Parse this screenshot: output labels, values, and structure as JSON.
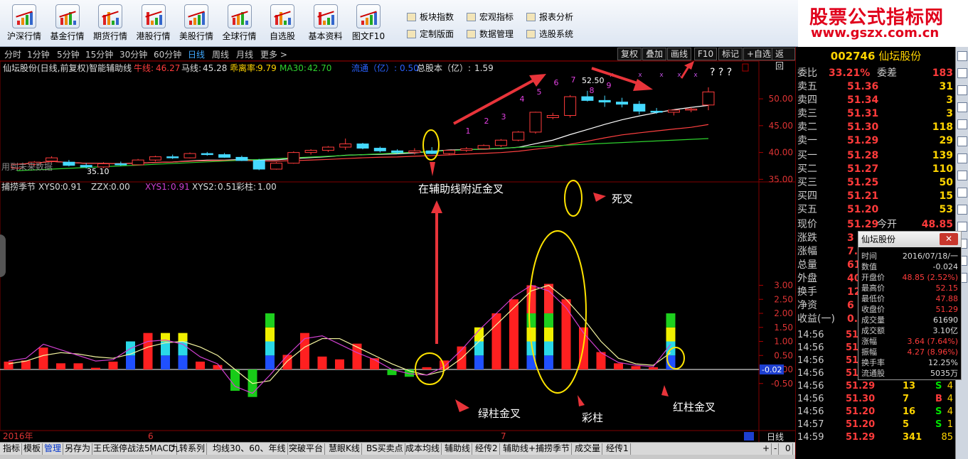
{
  "toolbar": {
    "buttons": [
      {
        "label": "沪深行情",
        "icon": "market-chart-icon"
      },
      {
        "label": "基金行情",
        "icon": "fund-chart-icon"
      },
      {
        "label": "期货行情",
        "icon": "futures-chart-icon"
      },
      {
        "label": "港股行情",
        "icon": "hk-chart-icon"
      },
      {
        "label": "美股行情",
        "icon": "us-chart-icon"
      },
      {
        "label": "全球行情",
        "icon": "global-chart-icon"
      },
      {
        "label": "自选股",
        "icon": "watchlist-icon"
      },
      {
        "label": "基本资料",
        "icon": "key-icon"
      },
      {
        "label": "图文F10",
        "icon": "f10-doc-icon"
      }
    ],
    "menu": [
      {
        "label": "板块指数"
      },
      {
        "label": "宏观指标"
      },
      {
        "label": "报表分析"
      },
      {
        "label": "定制版面"
      },
      {
        "label": "数据管理"
      },
      {
        "label": "选股系统"
      }
    ]
  },
  "brand": {
    "title": "股票公式指标网",
    "url": "www.gszx.com.cn"
  },
  "periods": [
    "分时",
    "1分钟",
    "5分钟",
    "15分钟",
    "30分钟",
    "60分钟",
    "日线",
    "周线",
    "月线",
    "更多 >"
  ],
  "active_period": "日线",
  "function_buttons": [
    "复权",
    "叠加",
    "画线",
    "F10",
    "标记",
    "+自选",
    "返回"
  ],
  "main_chart": {
    "legend": {
      "title": "仙坛股份(日线,前复权)智能辅助线",
      "ma1_label": "牛线:",
      "ma1_value": "46.27",
      "ma2_label": "马线:",
      "ma2_value": "45.28",
      "bias_label": "乖离率:",
      "bias_value": "9.79",
      "ma30_label": "MA30:",
      "ma30_value": "42.70",
      "float_label": "流通（亿）:",
      "float_value": "0.50",
      "total_label": "总股本（亿）:",
      "total_value": "1.59"
    },
    "yticks": [
      "50.00",
      "45.00",
      "40.00",
      "35.00"
    ],
    "low_label": "35.10",
    "high_label": "52.50",
    "future_label": "用到未来数据",
    "question_marks": "? ? ?",
    "candles": [
      [
        37.1,
        37.9,
        36.8,
        37.8
      ],
      [
        37.8,
        38.4,
        37.5,
        38.2
      ],
      [
        38.4,
        39.3,
        38.1,
        39.0
      ],
      [
        38.2,
        38.6,
        37.4,
        37.6
      ],
      [
        37.6,
        38.0,
        37.0,
        37.3
      ],
      [
        37.3,
        38.2,
        37.1,
        37.9
      ],
      [
        37.9,
        38.3,
        37.5,
        37.7
      ],
      [
        37.7,
        38.8,
        37.6,
        38.6
      ],
      [
        38.6,
        39.4,
        38.3,
        39.2
      ],
      [
        39.2,
        39.6,
        38.8,
        39.0
      ],
      [
        39.0,
        40.0,
        38.9,
        39.8
      ],
      [
        39.8,
        40.1,
        39.4,
        39.6
      ],
      [
        39.6,
        39.9,
        39.0,
        39.1
      ],
      [
        39.1,
        39.4,
        38.4,
        38.5
      ],
      [
        38.5,
        38.8,
        36.7,
        36.9
      ],
      [
        36.9,
        38.2,
        36.8,
        38.0
      ],
      [
        38.0,
        40.2,
        37.9,
        40.0
      ],
      [
        40.0,
        40.6,
        39.6,
        40.4
      ],
      [
        40.4,
        41.2,
        40.1,
        41.0
      ],
      [
        41.0,
        42.6,
        40.5,
        41.6
      ],
      [
        41.6,
        41.8,
        40.6,
        40.8
      ],
      [
        40.8,
        41.1,
        40.0,
        40.3
      ],
      [
        40.3,
        40.6,
        39.7,
        40.0
      ],
      [
        40.0,
        40.8,
        39.6,
        40.3
      ],
      [
        40.3,
        41.0,
        39.7,
        39.8
      ],
      [
        39.8,
        40.5,
        39.5,
        40.4
      ],
      [
        40.4,
        41.0,
        40.1,
        40.7
      ],
      [
        40.7,
        41.5,
        40.5,
        41.3
      ],
      [
        41.3,
        42.5,
        41.0,
        42.3
      ],
      [
        42.3,
        44.0,
        42.1,
        43.8
      ],
      [
        43.8,
        47.6,
        43.5,
        47.5
      ],
      [
        46.5,
        47.4,
        46.2,
        46.9
      ],
      [
        46.9,
        50.7,
        46.5,
        50.4
      ],
      [
        50.4,
        51.5,
        49.5,
        49.7
      ],
      [
        49.7,
        50.6,
        48.5,
        49.4
      ],
      [
        49.4,
        50.2,
        48.4,
        49.0
      ],
      [
        49.0,
        49.6,
        47.1,
        47.7
      ],
      [
        47.7,
        48.3,
        47.2,
        47.5
      ],
      [
        47.5,
        48.0,
        46.9,
        47.9
      ],
      [
        47.9,
        48.4,
        47.5,
        48.1
      ],
      [
        48.85,
        52.15,
        47.88,
        51.29
      ]
    ],
    "top_numbers": [
      "1",
      "2",
      "3",
      "4",
      "5",
      "6",
      "7",
      "8",
      "9"
    ],
    "annotation": "在辅助线附近金叉"
  },
  "sub_chart": {
    "legend": {
      "title": "捕捞季节",
      "xys0_label": "XYS0:",
      "xys0_value": "0.91",
      "zzx_label": "ZZX:",
      "zzx_value": "0.00",
      "xys1_label": "XYS1:",
      "xys1_value": "0.91",
      "xys2_label": "XYS2:",
      "xys2_value": "0.51",
      "caizhu_label": "彩柱:",
      "caizhu_value": "1.00"
    },
    "yticks": [
      "3.00",
      "2.50",
      "2.00",
      "1.50",
      "1.00",
      "0.50",
      "0.00",
      "-0.50"
    ],
    "current_value": "-0.02",
    "bars": [
      0.28,
      0.32,
      0.78,
      0.22,
      0.22,
      0.06,
      0.28,
      1.0,
      1.3,
      1.3,
      1.3,
      0.28,
      0.16,
      -0.76,
      -0.98,
      2.0,
      0.52,
      1.3,
      0.46,
      0.36,
      0.92,
      0.4,
      -0.2,
      -0.26,
      0.08,
      0.32,
      0.82,
      1.5,
      2.0,
      2.5,
      3.0,
      3.05,
      2.5,
      1.5,
      0.62,
      0.22,
      0.12,
      0.08,
      2.0
    ],
    "colorful": [
      false,
      false,
      false,
      false,
      false,
      false,
      false,
      true,
      false,
      true,
      true,
      false,
      false,
      false,
      false,
      true,
      false,
      false,
      false,
      false,
      false,
      false,
      false,
      false,
      false,
      false,
      false,
      true,
      false,
      false,
      true,
      true,
      false,
      false,
      false,
      false,
      false,
      false,
      true
    ],
    "line_xys1": [
      0.3,
      0.4,
      0.9,
      0.7,
      0.5,
      0.3,
      0.35,
      0.75,
      1.0,
      1.05,
      0.9,
      0.45,
      0.2,
      -0.6,
      -0.85,
      -0.2,
      0.5,
      1.1,
      1.2,
      0.9,
      0.6,
      0.35,
      0.0,
      -0.15,
      -0.2,
      0.1,
      0.7,
      1.4,
      2.0,
      2.6,
      3.0,
      2.8,
      2.2,
      1.3,
      0.6,
      0.25,
      0.15,
      0.1,
      0.9
    ],
    "line_xys2": [
      0.2,
      0.3,
      0.5,
      0.6,
      0.55,
      0.45,
      0.4,
      0.55,
      0.8,
      0.95,
      1.0,
      0.8,
      0.5,
      0.0,
      -0.5,
      -0.4,
      0.3,
      0.8,
      1.1,
      1.1,
      0.8,
      0.5,
      0.2,
      -0.05,
      -0.2,
      -0.05,
      0.4,
      1.0,
      1.6,
      2.2,
      2.8,
      3.0,
      2.5,
      1.8,
      1.0,
      0.4,
      0.2,
      0.15,
      0.6
    ],
    "annotations": {
      "death_cross": "死叉",
      "green_cross": "绿柱金叉",
      "colorful": "彩柱",
      "red_cross": "红柱金叉"
    }
  },
  "xaxis": {
    "labels": [
      "2016年",
      "6",
      "7"
    ],
    "period": "日线"
  },
  "tabs": [
    "指标",
    "模板",
    "管理",
    "另存为",
    "王氏涨停战法5",
    "MACD",
    "九转系列",
    "均线30、60、年线",
    "突破平台",
    "慧眼K线",
    "BS买卖点",
    "成本均线",
    "辅助线",
    "经传2",
    "辅助线+捕捞季节",
    "成交量",
    "经传1"
  ],
  "active_tab": "管理",
  "tab_controls": [
    "+",
    "-",
    "0"
  ],
  "quote": {
    "code": "002746",
    "name": "仙坛股份",
    "weibi_label": "委比",
    "weibi": "33.21%",
    "weicha_label": "委差",
    "weicha": "183",
    "asks": [
      {
        "label": "卖五",
        "price": "51.36",
        "vol": "31"
      },
      {
        "label": "卖四",
        "price": "51.34",
        "vol": "3"
      },
      {
        "label": "卖三",
        "price": "51.31",
        "vol": "3"
      },
      {
        "label": "卖二",
        "price": "51.30",
        "vol": "118"
      },
      {
        "label": "卖一",
        "price": "51.29",
        "vol": "29"
      }
    ],
    "bids": [
      {
        "label": "买一",
        "price": "51.28",
        "vol": "139"
      },
      {
        "label": "买二",
        "price": "51.27",
        "vol": "110"
      },
      {
        "label": "买三",
        "price": "51.25",
        "vol": "50"
      },
      {
        "label": "买四",
        "price": "51.21",
        "vol": "15"
      },
      {
        "label": "买五",
        "price": "51.20",
        "vol": "53"
      }
    ],
    "stats": [
      {
        "label": "现价",
        "value": "51.29",
        "label2": "今开",
        "value2": "48.85"
      },
      {
        "label": "涨跌",
        "value": "3"
      },
      {
        "label": "涨幅",
        "value": "7."
      },
      {
        "label": "总量",
        "value": "61"
      },
      {
        "label": "外盘",
        "value": "40"
      },
      {
        "label": "换手",
        "value": "12."
      },
      {
        "label": "净资",
        "value": "6"
      },
      {
        "label": "收益(一)",
        "value": "0."
      }
    ],
    "ticks": [
      {
        "time": "14:56",
        "price": "51"
      },
      {
        "time": "14:56",
        "price": "51"
      },
      {
        "time": "14:56",
        "price": "51"
      },
      {
        "time": "14:56",
        "price": "51"
      },
      {
        "time": "14:56",
        "price": "51.29",
        "vol": "13",
        "bs": "S",
        "n": "4"
      },
      {
        "time": "14:56",
        "price": "51.30",
        "vol": "7",
        "bs": "B",
        "n": "4"
      },
      {
        "time": "14:56",
        "price": "51.20",
        "vol": "16",
        "bs": "S",
        "n": "4"
      },
      {
        "time": "14:57",
        "price": "51.20",
        "vol": "5",
        "bs": "S",
        "n": "1"
      },
      {
        "time": "14:59",
        "price": "51.29",
        "vol": "341",
        "bs": "",
        "n": "85"
      }
    ],
    "colors": {
      "up": "#ff3b3b",
      "down": "#00e000",
      "accent": "#ffd400"
    }
  },
  "popup": {
    "title": "仙坛股份",
    "rows": [
      {
        "label": "时间",
        "value": "2016/07/18/一"
      },
      {
        "label": "数值",
        "value": "-0.024"
      },
      {
        "label": "开盘价",
        "value": "48.85 (2.52%)"
      },
      {
        "label": "最高价",
        "value": "52.15"
      },
      {
        "label": "最低价",
        "value": "47.88"
      },
      {
        "label": "收盘价",
        "value": "51.29"
      },
      {
        "label": "成交量",
        "value": "61690"
      },
      {
        "label": "成交额",
        "value": "3.10亿"
      },
      {
        "label": "涨幅",
        "value": "3.64 (7.64%)"
      },
      {
        "label": "振幅",
        "value": "4.27 (8.96%)"
      },
      {
        "label": "换手率",
        "value": "12.25%"
      },
      {
        "label": "流通股",
        "value": "5035万"
      }
    ]
  }
}
